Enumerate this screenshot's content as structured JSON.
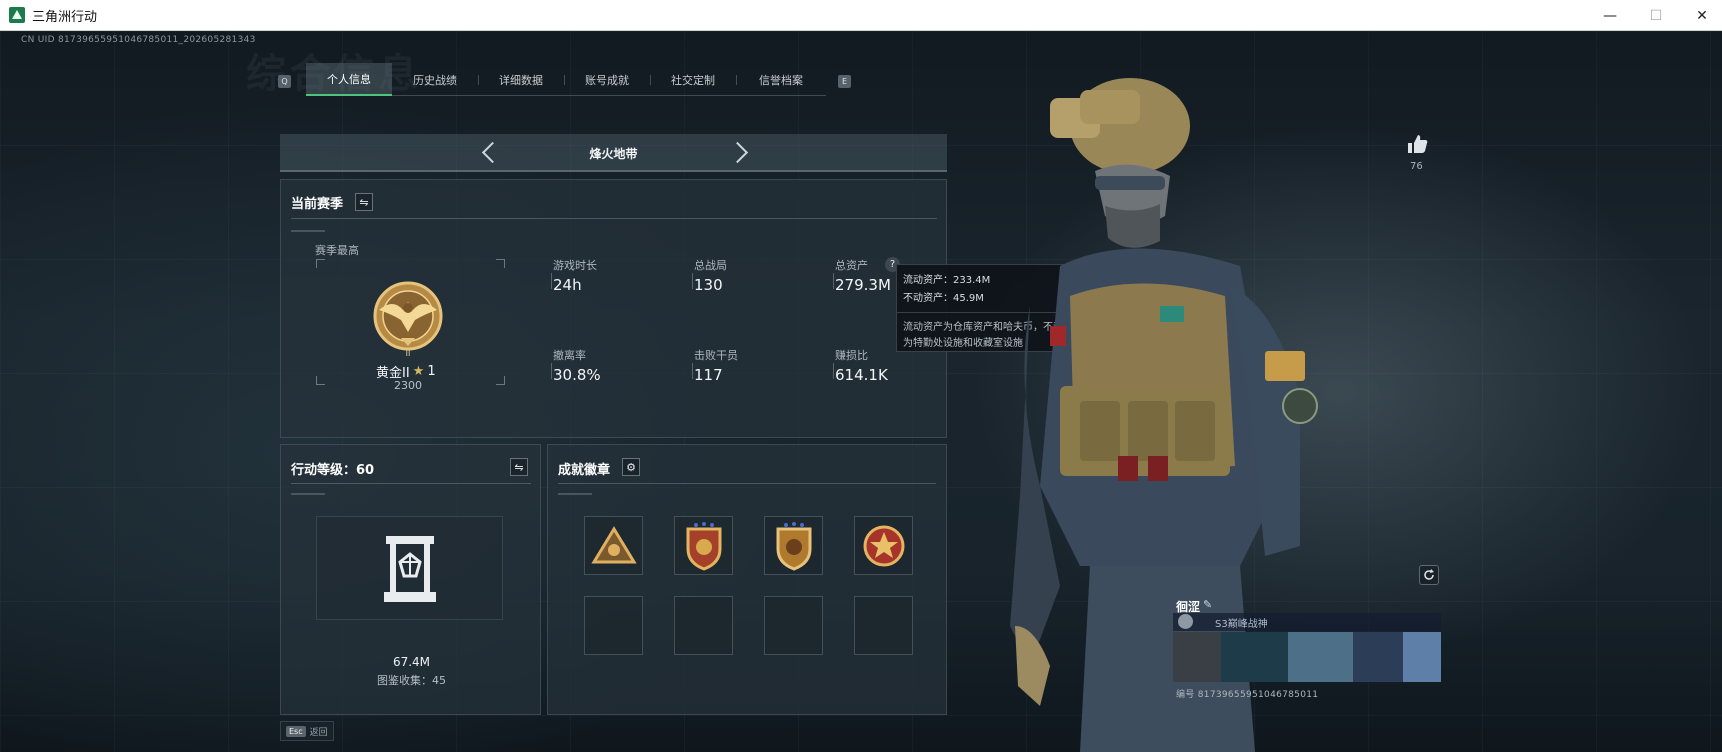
{
  "window": {
    "title": "三角洲行动",
    "minimize": "—",
    "maximize": "☐",
    "close": "✕"
  },
  "header": {
    "uid": "CN UID 8173965595104678501​1_202605281343",
    "bg_title": "综合信息"
  },
  "tabs": {
    "key_left": "Q",
    "key_right": "E",
    "items": [
      {
        "label": "个人信息",
        "active": true
      },
      {
        "label": "历史战绩"
      },
      {
        "label": "详细数据"
      },
      {
        "label": "账号成就"
      },
      {
        "label": "社交定制"
      },
      {
        "label": "信誉档案"
      }
    ]
  },
  "mode": {
    "title": "烽火地带"
  },
  "season": {
    "title": "当前赛季",
    "switch_icon": "⇋",
    "best_label": "赛季最高",
    "rank_name": "黄金II",
    "rank_stars": "1",
    "rank_score": "2300",
    "stats": [
      {
        "label": "游戏时长",
        "value": "24h"
      },
      {
        "label": "总战局",
        "value": "130"
      },
      {
        "label": "总资产",
        "value": "279.3M"
      },
      {
        "label": "撤离率",
        "value": "30.8%"
      },
      {
        "label": "击败干员",
        "value": "117"
      },
      {
        "label": "赚损比",
        "value": "614.1K"
      }
    ],
    "help_icon": "?"
  },
  "tooltip": {
    "liquid": "流动资产：233.4M",
    "fixed": "不动资产：45.9M",
    "desc1": "流动资产为仓库资产和哈夫币，不动资产",
    "desc2": "为特勤处设施和收藏室设施"
  },
  "level": {
    "title": "行动等级：60",
    "switch_icon": "⇋",
    "collection_value": "67.4M",
    "collection_label": "图鉴收集：45"
  },
  "achievements": {
    "title": "成就徽章",
    "settings_icon": "⚙",
    "filled": 4,
    "empty": 4
  },
  "bottom": {
    "esc_key": "Esc",
    "esc_label": "返回"
  },
  "profile": {
    "likes": "76",
    "name": "徊涩",
    "edit_icon": "✎",
    "title": "S3巅峰战神",
    "id": "编号 81739655951046785011"
  },
  "colors": {
    "accent_green": "#4ec37b",
    "gold": "#c9a258",
    "panel_bg": "#26323a"
  }
}
